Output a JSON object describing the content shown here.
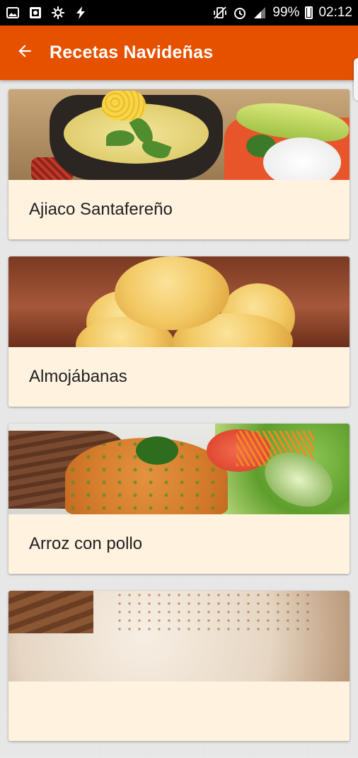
{
  "status_bar": {
    "battery_percent": "99%",
    "battery_level": 0.99,
    "time": "02:12",
    "left_icons": [
      "image-icon",
      "photo-icon",
      "settings-cog-icon",
      "flash-icon"
    ],
    "right_icons": [
      "mute-vibrate-icon",
      "alarm-icon",
      "signal-icon",
      "battery-icon"
    ]
  },
  "app_bar": {
    "title": "Recetas Navideñas",
    "back_icon": "back-arrow-icon",
    "color": "#e65100"
  },
  "recipes": [
    {
      "name": "Ajiaco Santafereño",
      "image": "ajiaco-image"
    },
    {
      "name": "Almojábanas",
      "image": "almojabanas-image"
    },
    {
      "name": "Arroz con pollo",
      "image": "arroz-con-pollo-image"
    },
    {
      "name": "",
      "image": "dessert-image"
    }
  ],
  "colors": {
    "card_background": "#fff3e0",
    "accent": "#e65100"
  }
}
